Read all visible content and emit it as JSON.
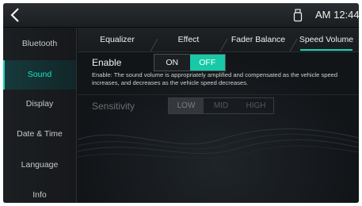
{
  "status": {
    "back_icon": "chevron-left-icon",
    "usb_icon": "usb-icon",
    "time": "AM 12:44"
  },
  "sidebar": {
    "items": [
      {
        "label": "Bluetooth",
        "active": false
      },
      {
        "label": "Sound",
        "active": true
      },
      {
        "label": "Display",
        "active": false
      },
      {
        "label": "Date & Time",
        "active": false
      },
      {
        "label": "Language",
        "active": false
      },
      {
        "label": "Info",
        "active": false
      }
    ]
  },
  "tabs": [
    {
      "label": "Equalizer"
    },
    {
      "label": "Effect"
    },
    {
      "label": "Fader Balance"
    },
    {
      "label": "Speed Volume",
      "active": true
    }
  ],
  "enable": {
    "label": "Enable",
    "on": "ON",
    "off": "OFF",
    "selected": "OFF",
    "description": "Enable: The sound volume is appropriately amplified and compensated as the vehicle speed increases, and decreases as the vehicle speed decreases."
  },
  "sensitivity": {
    "label": "Sensitivity",
    "options": [
      "LOW",
      "MID",
      "HIGH"
    ],
    "selected": "LOW"
  },
  "colors": {
    "accent": "#19d4b6",
    "background": "#111416"
  }
}
